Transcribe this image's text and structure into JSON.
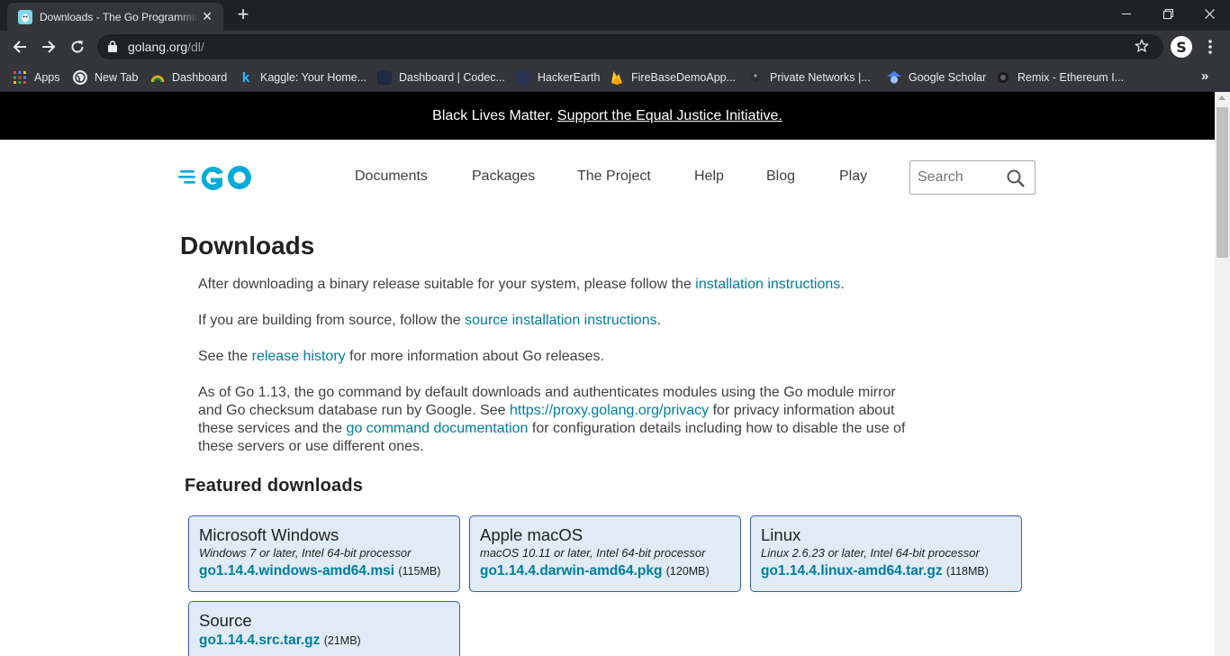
{
  "browser": {
    "tab_title": "Downloads - The Go Programming Language",
    "tab_close": "✕",
    "new_tab": "+",
    "url_domain": "golang.org",
    "url_path": "/dl/",
    "profile_initial": "S",
    "bookmarks": [
      {
        "label": "Apps",
        "icon": "apps-grid-icon"
      },
      {
        "label": "New Tab",
        "icon": "globe-icon"
      },
      {
        "label": "Dashboard",
        "icon": "dashboard-icon"
      },
      {
        "label": "Kaggle: Your Home...",
        "icon": "kaggle-icon"
      },
      {
        "label": "Dashboard | Codec...",
        "icon": "codecademy-icon"
      },
      {
        "label": "HackerEarth",
        "icon": "hackerearth-icon"
      },
      {
        "label": "FireBaseDemoApp...",
        "icon": "firebase-icon"
      },
      {
        "label": "Private Networks |...",
        "icon": "network-icon"
      },
      {
        "label": "Google Scholar",
        "icon": "scholar-icon"
      },
      {
        "label": "Remix - Ethereum I...",
        "icon": "remix-icon"
      }
    ],
    "bookmarks_more": "»"
  },
  "banner": {
    "text": "Black Lives Matter. ",
    "link": "Support the Equal Justice Initiative."
  },
  "nav": {
    "items": [
      "Documents",
      "Packages",
      "The Project",
      "Help",
      "Blog",
      "Play"
    ],
    "search_placeholder": "Search"
  },
  "page": {
    "title": "Downloads",
    "p1": {
      "before": "After downloading a binary release suitable for your system, please follow the ",
      "link": "installation instructions",
      "after": "."
    },
    "p2": {
      "before": "If you are building from source, follow the ",
      "link": "source installation instructions",
      "after": "."
    },
    "p3": {
      "before": "See the ",
      "link": "release history",
      "after": " for more information about Go releases."
    },
    "p4": {
      "t1": "As of Go 1.13, the go command by default downloads and authenticates modules using the Go module mirror and Go checksum database run by Google. See ",
      "link1": "https://proxy.golang.org/privacy",
      "t2": " for privacy information about these services and the ",
      "link2": "go command documentation",
      "t3": " for configuration details including how to disable the use of these servers or use different ones."
    },
    "featured_heading": "Featured downloads",
    "downloads": [
      {
        "os": "Microsoft Windows",
        "desc": "Windows 7 or later, Intel 64-bit processor",
        "file": "go1.14.4.windows-amd64.msi",
        "size": "(115MB)"
      },
      {
        "os": "Apple macOS",
        "desc": "macOS 10.11 or later, Intel 64-bit processor",
        "file": "go1.14.4.darwin-amd64.pkg",
        "size": "(120MB)"
      },
      {
        "os": "Linux",
        "desc": "Linux 2.6.23 or later, Intel 64-bit processor",
        "file": "go1.14.4.linux-amd64.tar.gz",
        "size": "(118MB)"
      },
      {
        "os": "Source",
        "desc": "",
        "file": "go1.14.4.src.tar.gz",
        "size": "(21MB)"
      }
    ]
  },
  "colors": {
    "link": "#007d9c",
    "card_bg": "#e0ebf5",
    "card_border": "#375eab",
    "go_logo": "#00acd7"
  }
}
